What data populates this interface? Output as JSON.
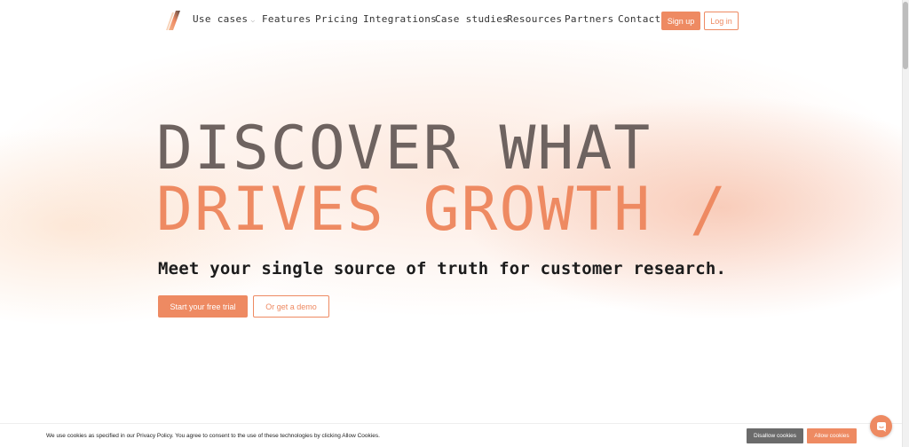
{
  "nav": {
    "items": [
      {
        "label": "Use cases",
        "has_dropdown": true
      },
      {
        "label": "Features"
      },
      {
        "label": "Pricing"
      },
      {
        "label": "Integrations"
      },
      {
        "label": "Case studies"
      },
      {
        "label": "Resources"
      },
      {
        "label": "Partners"
      },
      {
        "label": "Contact"
      }
    ],
    "signup_label": "Sign up",
    "login_label": "Log in",
    "dropdown_glyph": "⌵"
  },
  "hero": {
    "line1": "DISCOVER WHAT",
    "line2": "DRIVES GROWTH /",
    "subhead": "Meet your single source of truth for customer research.",
    "cta_primary": "Start your free trial",
    "cta_secondary": "Or get a demo"
  },
  "cookie": {
    "text": "We use cookies as specified in our Privacy Policy. You agree to consent to the use of these technologies by clicking Allow Cookies.",
    "disallow_label": "Disallow cookies",
    "allow_label": "Allow cookies"
  },
  "colors": {
    "accent": "#ee8a62",
    "heading_dark": "#6e6360",
    "text_dark": "#1c1c1c",
    "button_gray": "#6b6b6b"
  },
  "icons": {
    "logo": "slash-logo-icon",
    "chat": "chat-bubble-icon",
    "dropdown": "chevron-down-icon"
  }
}
